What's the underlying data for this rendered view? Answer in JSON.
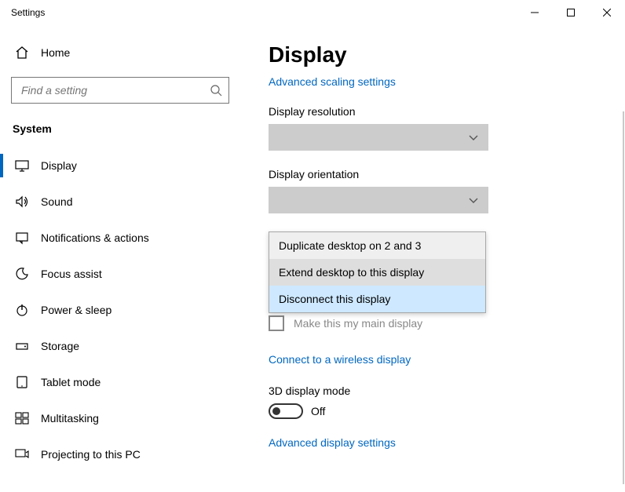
{
  "window": {
    "title": "Settings"
  },
  "sidebar": {
    "home_label": "Home",
    "search_placeholder": "Find a setting",
    "section_label": "System",
    "items": [
      {
        "label": "Display"
      },
      {
        "label": "Sound"
      },
      {
        "label": "Notifications & actions"
      },
      {
        "label": "Focus assist"
      },
      {
        "label": "Power & sleep"
      },
      {
        "label": "Storage"
      },
      {
        "label": "Tablet mode"
      },
      {
        "label": "Multitasking"
      },
      {
        "label": "Projecting to this PC"
      }
    ]
  },
  "content": {
    "title": "Display",
    "adv_scaling_link": "Advanced scaling settings",
    "resolution_label": "Display resolution",
    "orientation_label": "Display orientation",
    "dropdown": {
      "option0": "Duplicate desktop on 2 and 3",
      "option1": "Extend desktop to this display",
      "option2": "Disconnect this display"
    },
    "main_display_checkbox": "Make this my main display",
    "wireless_link": "Connect to a wireless display",
    "three_d_label": "3D display mode",
    "toggle_state": "Off",
    "adv_display_link": "Advanced display settings"
  }
}
